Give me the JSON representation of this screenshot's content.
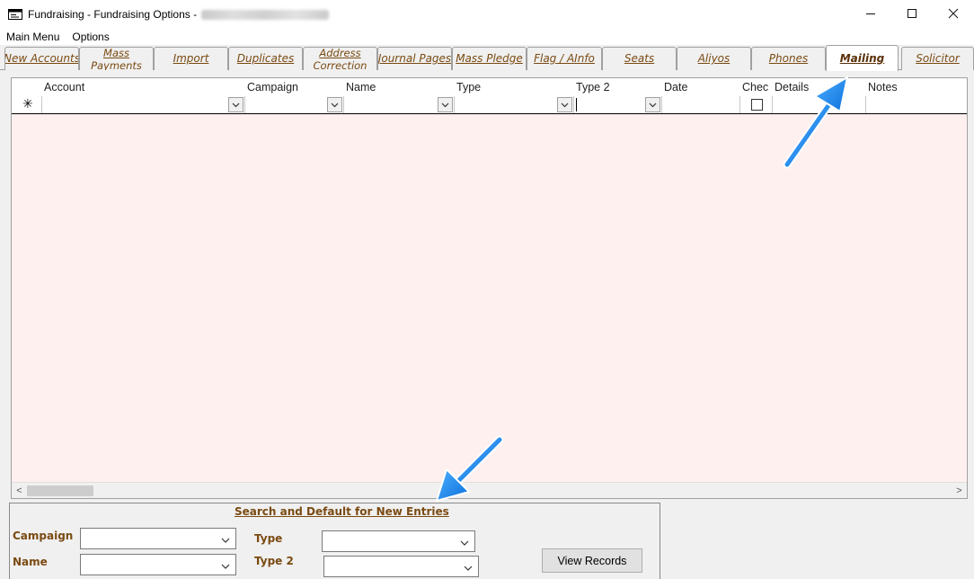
{
  "window": {
    "title": "Fundraising - Fundraising Options -",
    "minimize_glyph": "—",
    "maximize_glyph": "☐",
    "close_glyph": "✕"
  },
  "menu": {
    "items": [
      {
        "label": "Main Menu"
      },
      {
        "label": "Options"
      }
    ]
  },
  "tabs": [
    {
      "label": "New Accounts",
      "active": false
    },
    {
      "label": "Mass Payments",
      "active": false
    },
    {
      "label": "Import",
      "active": false
    },
    {
      "label": "Duplicates",
      "active": false
    },
    {
      "label": "Address Correction",
      "active": false
    },
    {
      "label": "Journal Pages",
      "active": false
    },
    {
      "label": "Mass Pledge",
      "active": false
    },
    {
      "label": "Flag / AInfo",
      "active": false
    },
    {
      "label": "Seats",
      "active": false
    },
    {
      "label": "Aliyos",
      "active": false
    },
    {
      "label": "Phones",
      "active": false
    },
    {
      "label": "Mailing",
      "active": true
    },
    {
      "label": "Solicitor",
      "active": false
    }
  ],
  "grid": {
    "new_row_marker": "✳",
    "columns": [
      {
        "label": "Account"
      },
      {
        "label": "Campaign"
      },
      {
        "label": "Name"
      },
      {
        "label": "Type"
      },
      {
        "label": "Type 2"
      },
      {
        "label": "Date"
      },
      {
        "label": "Chec"
      },
      {
        "label": "Details"
      },
      {
        "label": "Notes"
      }
    ],
    "scroll_left": "<",
    "scroll_right": ">"
  },
  "search_panel": {
    "title": "Search and Default for New Entries",
    "campaign_label": "Campaign",
    "name_label": "Name",
    "type_label": "Type",
    "type2_label": "Type 2",
    "campaign_value": "",
    "name_value": "",
    "type_value": "",
    "type2_value": "",
    "view_button": "View Records"
  },
  "colors": {
    "tab_text": "#7a4a12",
    "grid_body": "#fff0f0",
    "annotation_arrow": "#1e8cf0"
  }
}
